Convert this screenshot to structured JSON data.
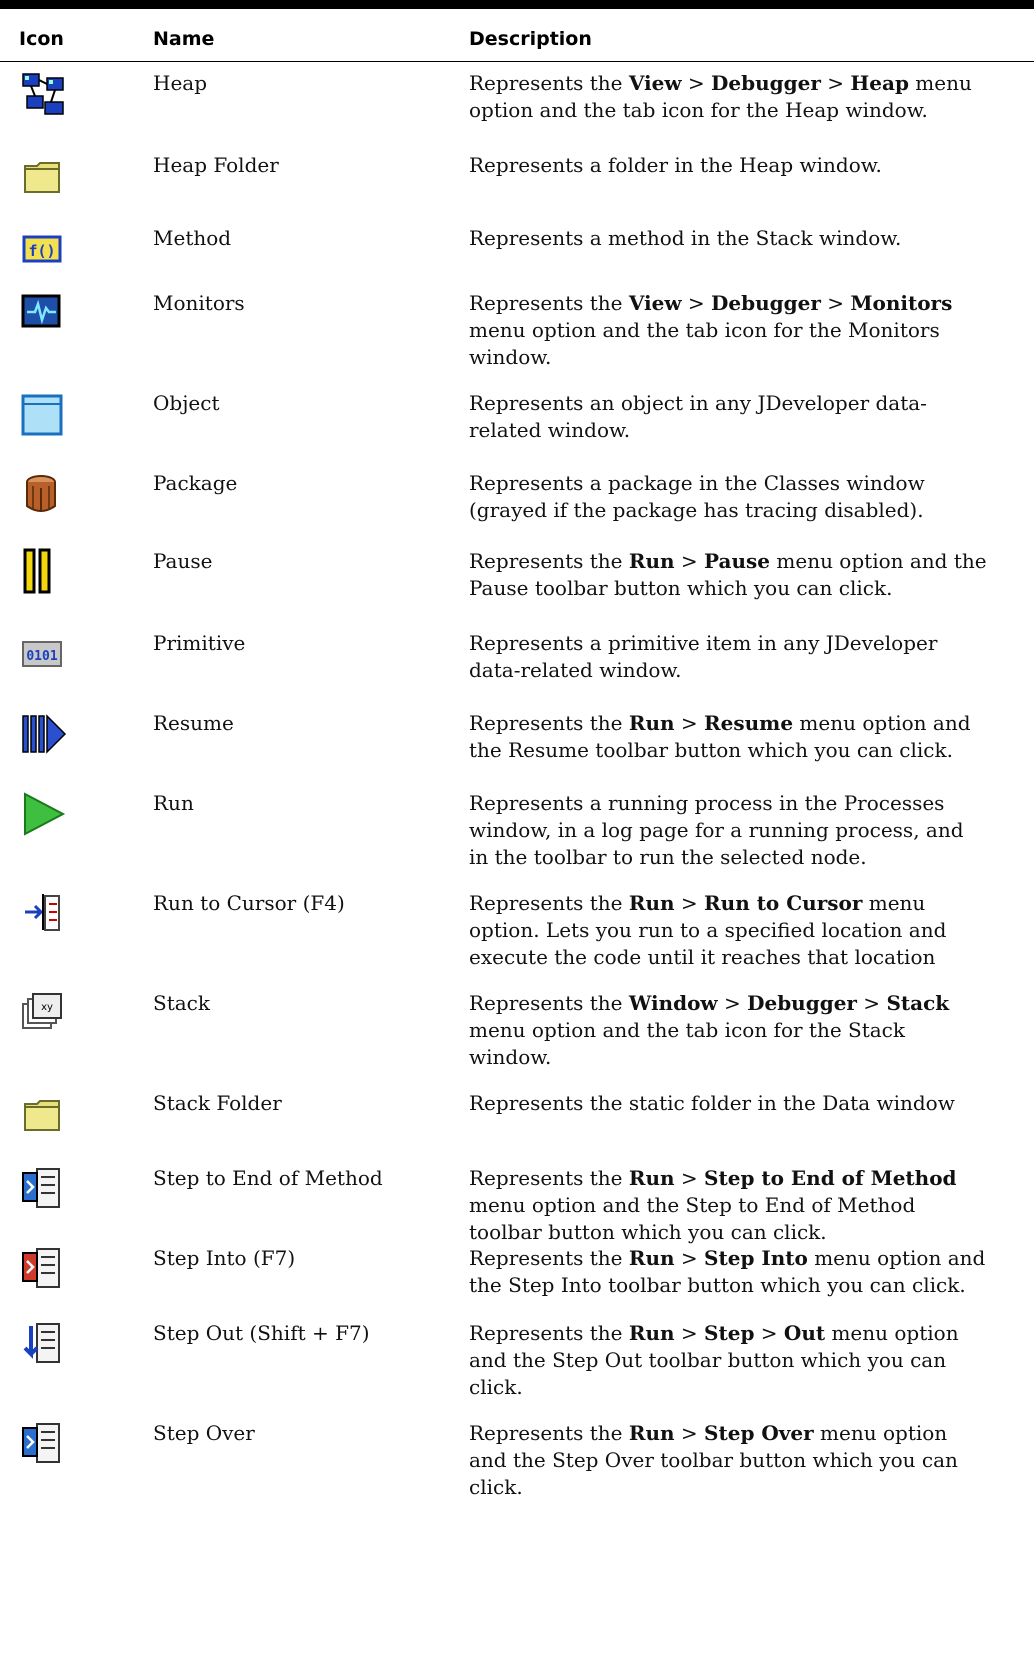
{
  "table": {
    "headers": {
      "icon": "Icon",
      "name": "Name",
      "description": "Description"
    },
    "rows": [
      {
        "icon": "heap-icon",
        "name": "Heap",
        "description": [
          "Represents the ",
          {
            "b": "View"
          },
          " > ",
          {
            "b": "Debugger"
          },
          " > ",
          {
            "b": "Heap"
          },
          " menu option and the tab icon for the Heap window."
        ]
      },
      {
        "icon": "heap-folder-icon",
        "name": "Heap Folder",
        "description": [
          "Represents a folder in the Heap window."
        ]
      },
      {
        "icon": "method-icon",
        "name": "Method",
        "description": [
          "Represents a method in the Stack window."
        ]
      },
      {
        "icon": "monitors-icon",
        "name": "Monitors",
        "description": [
          "Represents the ",
          {
            "b": "View"
          },
          " > ",
          {
            "b": "Debugger"
          },
          " > ",
          {
            "b": "Monitors"
          },
          " menu option and the tab icon for the Monitors window."
        ]
      },
      {
        "icon": "object-icon",
        "name": "Object",
        "description": [
          "Represents an object in any JDeveloper data-related window."
        ]
      },
      {
        "icon": "package-icon",
        "name": "Package",
        "description": [
          "Represents a package in the Classes window (grayed if the package has tracing disabled)."
        ]
      },
      {
        "icon": "pause-icon",
        "name": "Pause",
        "description": [
          "Represents the ",
          {
            "b": "Run"
          },
          " > ",
          {
            "b": "Pause"
          },
          " menu option and the Pause toolbar button which you can click."
        ]
      },
      {
        "icon": "primitive-icon",
        "name": "Primitive",
        "description": [
          "Represents a primitive item in any JDeveloper data-related window."
        ]
      },
      {
        "icon": "resume-icon",
        "name": "Resume",
        "description": [
          "Represents the ",
          {
            "b": "Run"
          },
          " > ",
          {
            "b": "Resume"
          },
          " menu option and the Resume toolbar button which you can click."
        ]
      },
      {
        "icon": "run-icon",
        "name": "Run",
        "description": [
          "Represents a running process in the Processes window, in a log page for a running process, and in the toolbar to run the selected node."
        ]
      },
      {
        "icon": "run-to-cursor-icon",
        "name": "Run to Cursor (F4)",
        "description": [
          "Represents the ",
          {
            "b": "Run"
          },
          " > ",
          {
            "b": "Run to Cursor"
          },
          " menu option. Lets you run to a specified location and execute the code until it reaches that location"
        ]
      },
      {
        "icon": "stack-icon",
        "name": "Stack",
        "description": [
          "Represents the ",
          {
            "b": "Window"
          },
          " > ",
          {
            "b": "Debugger"
          },
          " > ",
          {
            "b": "Stack"
          },
          " menu option and the tab icon for the Stack window."
        ]
      },
      {
        "icon": "stack-folder-icon",
        "name": "Stack Folder",
        "description": [
          "Represents the static folder in the Data window"
        ]
      },
      {
        "icon": "step-to-end-of-method-icon",
        "name": "Step to End of Method",
        "description": [
          "Represents the ",
          {
            "b": "Run"
          },
          " > ",
          {
            "b": "Step to End of Method"
          },
          " menu option and the Step to End of Method toolbar button which you can click."
        ]
      },
      {
        "icon": "step-into-icon",
        "name": "Step Into (F7)",
        "description": [
          "Represents the ",
          {
            "b": "Run"
          },
          " > ",
          {
            "b": "Step Into"
          },
          " menu option and the Step Into toolbar button which you can click."
        ]
      },
      {
        "icon": "step-out-icon",
        "name": "Step Out (Shift + F7)",
        "description": [
          "Represents the ",
          {
            "b": "Run"
          },
          " > ",
          {
            "b": "Step"
          },
          " > ",
          {
            "b": "Out"
          },
          " menu option and the Step Out toolbar button which you can click."
        ]
      },
      {
        "icon": "step-over-icon",
        "name": "Step Over",
        "description": [
          "Represents the ",
          {
            "b": "Run"
          },
          " > ",
          {
            "b": "Step Over"
          },
          " menu option and the Step Over toolbar button which you can click."
        ]
      }
    ]
  }
}
